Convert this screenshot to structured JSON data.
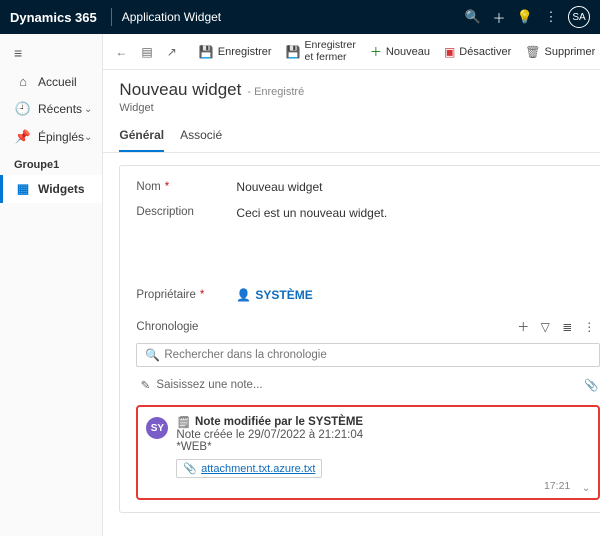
{
  "topbar": {
    "brand": "Dynamics 365",
    "app": "Application Widget",
    "avatar": "SA"
  },
  "sidebar": {
    "home": "Accueil",
    "recent": "Récents",
    "pinned": "Épinglés",
    "group": "Groupe1",
    "widgets": "Widgets"
  },
  "cmd": {
    "save": "Enregistrer",
    "saveclose1": "Enregistrer",
    "saveclose2": "et fermer",
    "new": "Nouveau",
    "deactivate": "Désactiver",
    "delete": "Supprimer"
  },
  "header": {
    "title": "Nouveau widget",
    "status": "- Enregistré",
    "subtitle": "Widget"
  },
  "tabs": {
    "general": "Général",
    "related": "Associé"
  },
  "form": {
    "name_label": "Nom",
    "name_value": "Nouveau widget",
    "desc_label": "Description",
    "desc_value": "Ceci est un nouveau widget.",
    "owner_label": "Propriétaire",
    "owner_value": "SYSTÈME"
  },
  "timeline": {
    "title": "Chronologie",
    "search_ph": "Rechercher dans la chronologie",
    "note_ph": "Saisissez une note...",
    "note": {
      "avatar": "SY",
      "title": "Note modifiée par le SYSTÈME",
      "line1": "Note créée le 29/07/2022 à 21:21:04",
      "line2": "*WEB*",
      "attachment": "attachment.txt.azure.txt",
      "time": "17:21"
    }
  }
}
